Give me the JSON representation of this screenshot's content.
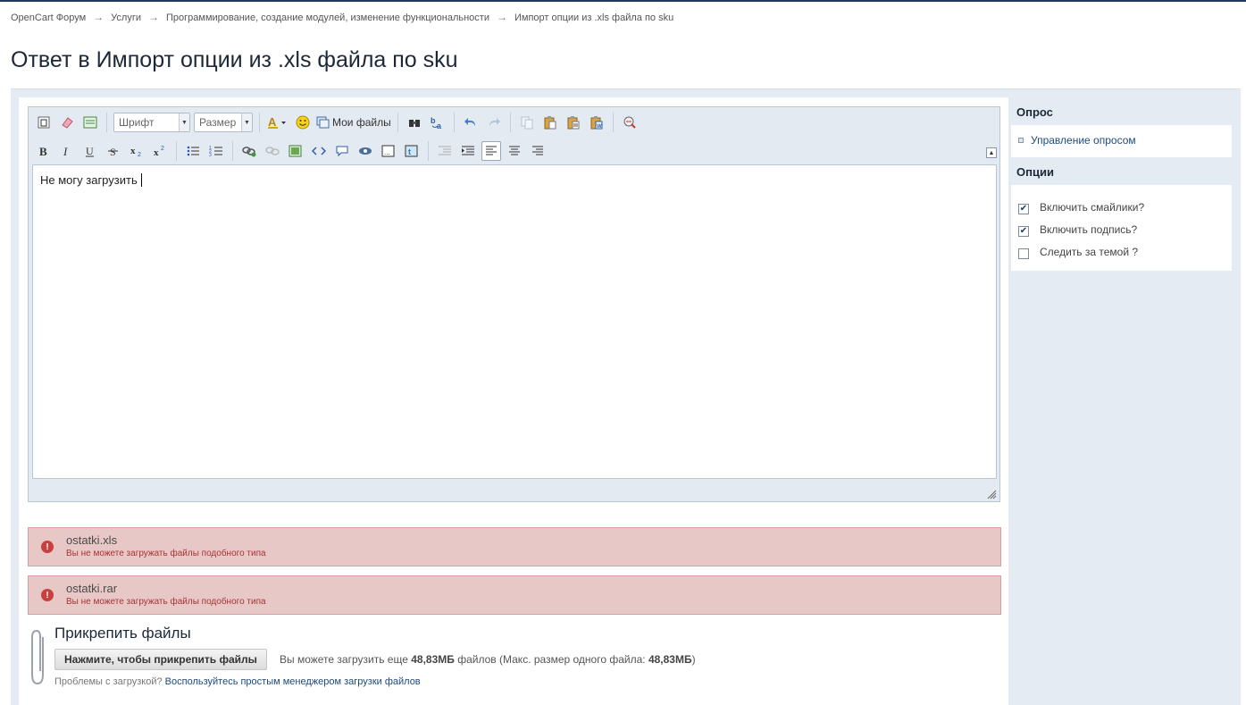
{
  "breadcrumb": [
    "OpenCart Форум",
    "Услуги",
    "Программирование, создание модулей, изменение функциональности",
    "Импорт опции из .xls файла по sku"
  ],
  "breadcrumb_separator": "→",
  "page_title": "Ответ в Импорт опции из .xls файла по sku",
  "toolbar": {
    "font_combo": "Шрифт",
    "size_combo": "Размер",
    "my_files_label": "Мои файлы"
  },
  "editor": {
    "content": "Не могу загрузить"
  },
  "errors": [
    {
      "file": "ostatki.xls",
      "message": "Вы не можете загружать файлы подобного типа"
    },
    {
      "file": "ostatki.rar",
      "message": "Вы не можете загружать файлы подобного типа"
    }
  ],
  "attach": {
    "title": "Прикрепить файлы",
    "button": "Нажмите, чтобы прикрепить файлы",
    "info_prefix": "Вы можете загрузить еще",
    "remaining": "48,83МБ",
    "info_middle": "файлов (Макс. размер одного файла:",
    "max_size": "48,83МБ",
    "info_suffix": ")",
    "help_text": "Проблемы с загрузкой?",
    "help_link": "Воспользуйтесь простым менеджером загрузки файлов"
  },
  "sidebar": {
    "poll_title": "Опрос",
    "poll_link": "Управление опросом",
    "options_title": "Опции",
    "options": [
      {
        "label": "Включить смайлики?",
        "checked": true
      },
      {
        "label": "Включить подпись?",
        "checked": true
      },
      {
        "label": "Следить за темой ?",
        "checked": false
      }
    ]
  },
  "colors": {
    "title_text": "#1c2837",
    "link": "#1d4a7c",
    "error_bg": "#e8c7c7",
    "panel_bg": "#e4ebf2"
  }
}
